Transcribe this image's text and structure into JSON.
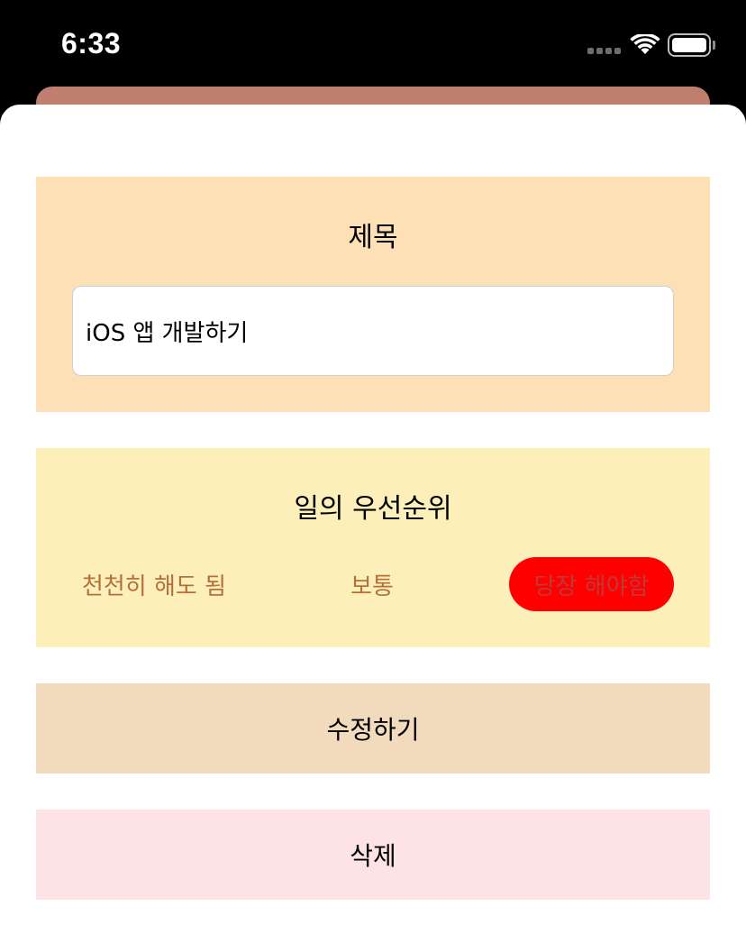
{
  "status_bar": {
    "time": "6:33",
    "signal_icon": "cellular-signal-icon",
    "wifi_icon": "wifi-icon",
    "battery_icon": "battery-icon",
    "battery_level": 1.0
  },
  "form": {
    "title_section": {
      "heading": "제목",
      "input_value": "iOS 앱 개발하기",
      "background": "#fde0b6"
    },
    "priority_section": {
      "heading": "일의 우선순위",
      "options": [
        {
          "label": "천천히 해도 됨",
          "selected": false
        },
        {
          "label": "보통",
          "selected": false
        },
        {
          "label": "당장 해야함",
          "selected": true
        }
      ],
      "selected_color": "#ff0000",
      "option_text_color": "#b5703a",
      "background": "#fdefba"
    },
    "edit_button": {
      "label": "수정하기",
      "background": "#f2dbbc"
    },
    "delete_button": {
      "label": "삭제",
      "background": "#fde3e6"
    }
  },
  "colors": {
    "back_card": "#bf7e6e",
    "sheet": "#ffffff"
  }
}
